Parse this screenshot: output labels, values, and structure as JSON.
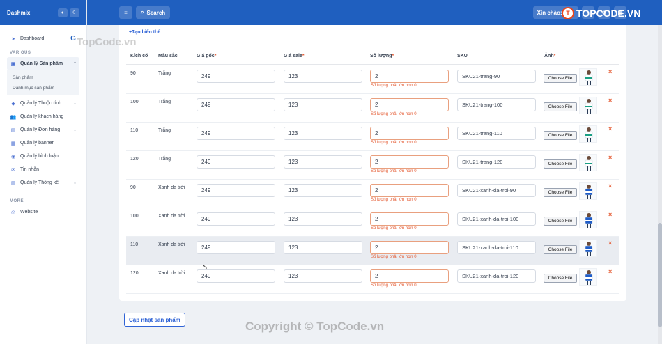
{
  "brand": {
    "name": "Dashmix"
  },
  "header": {
    "search_label": "Search",
    "user_label": "Xin chào: Huy"
  },
  "watermark": {
    "logo_text": "TOPCODE.VN",
    "top_text": "TopCode.vn",
    "bottom_text": "Copyright © TopCode.vn"
  },
  "sidebar": {
    "dashboard": "Dashboard",
    "various_heading": "VARIOUS",
    "product_mgmt": "Quản lý Sản phẩm",
    "sub_products": "Sản phẩm",
    "sub_categories": "Danh mục sản phẩm",
    "attributes": "Quản lý Thuộc tính",
    "customers": "Quản lý khách hàng",
    "orders": "Quản lý Đơn hàng",
    "banner": "Quản lý banner",
    "comments": "Quản lý bình luận",
    "messages": "Tin nhắn",
    "stats": "Quản lý Thống kê",
    "more_heading": "MORE",
    "website": "Website"
  },
  "form": {
    "add_variant": "+Tạo biến thể",
    "columns": {
      "size": "Kích cỡ",
      "color": "Màu sắc",
      "price": "Giá gốc",
      "sale": "Giá sale",
      "qty": "Số lượng",
      "sku": "SKU",
      "image": "Ảnh"
    },
    "required_mark": "*",
    "file_button": "Choose File",
    "remove_icon": "×",
    "rows": [
      {
        "size": "90",
        "color": "Trắng",
        "price": "249",
        "sale": "123",
        "qty": "2",
        "error": "Số lượng phải lớn hơn 0",
        "sku": "SKU21-trang-90"
      },
      {
        "size": "100",
        "color": "Trắng",
        "price": "249",
        "sale": "123",
        "qty": "2",
        "error": "Số lượng phải lớn hơn 0",
        "sku": "SKU21-trang-100"
      },
      {
        "size": "110",
        "color": "Trắng",
        "price": "249",
        "sale": "123",
        "qty": "2",
        "error": "Số lượng phải lớn hơn 0",
        "sku": "SKU21-trang-110"
      },
      {
        "size": "120",
        "color": "Trắng",
        "price": "249",
        "sale": "123",
        "qty": "2",
        "error": "Số lượng phải lớn hơn 0",
        "sku": "SKU21-trang-120"
      },
      {
        "size": "90",
        "color": "Xanh da trời",
        "price": "249",
        "sale": "123",
        "qty": "2",
        "error": "Số lượng phải lớn hơn 0",
        "sku": "SKU21-xanh-da-troi-90"
      },
      {
        "size": "100",
        "color": "Xanh da trời",
        "price": "249",
        "sale": "123",
        "qty": "2",
        "error": "Số lượng phải lớn hơn 0",
        "sku": "SKU21-xanh-da-troi-100"
      },
      {
        "size": "110",
        "color": "Xanh da trời",
        "price": "249",
        "sale": "123",
        "qty": "2",
        "error": "Số lượng phải lớn hơn 0",
        "sku": "SKU21-xanh-da-troi-110"
      },
      {
        "size": "120",
        "color": "Xanh da trời",
        "price": "249",
        "sale": "123",
        "qty": "2",
        "error": "Số lượng phải lớn hơn 0",
        "sku": "SKU21-xanh-da-troi-120"
      }
    ],
    "update_button": "Cập nhật sản phẩm"
  },
  "colors": {
    "header": "#1f5fbf",
    "accent": "#2f63d6",
    "error": "#e4572e",
    "shirt_white": "#ffffff",
    "shirt_blue": "#1e5cc8",
    "shirt_trim": "#1aa085"
  }
}
